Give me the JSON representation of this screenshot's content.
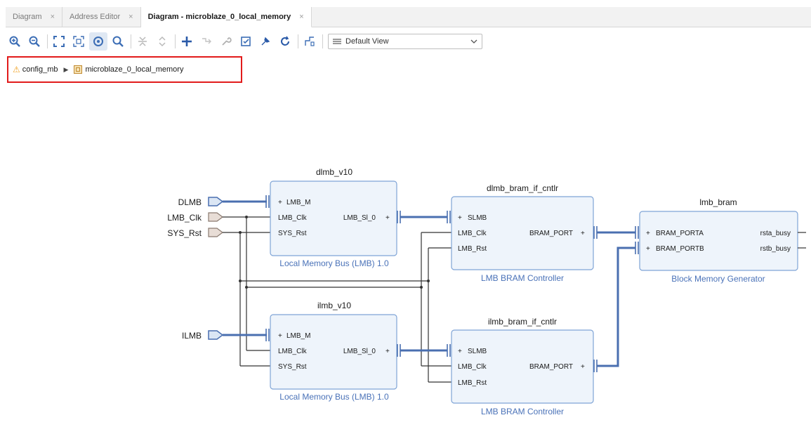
{
  "tabs": [
    {
      "label": "Diagram",
      "active": false
    },
    {
      "label": "Address Editor",
      "active": false
    },
    {
      "label": "Diagram - microblaze_0_local_memory",
      "active": true
    }
  ],
  "tab_close_glyph": "×",
  "toolbar": {
    "icons": [
      "zoom-in-icon",
      "zoom-out-icon",
      "fit-icon",
      "fit-selection-icon",
      "autofit-icon",
      "search-icon",
      "collapse-icon",
      "expand-icon",
      "add-ip-icon",
      "make-connection-icon",
      "settings-icon",
      "validate-icon",
      "run-automation-icon",
      "regenerate-layout-icon",
      "optimize-routing-icon"
    ],
    "view_label": "Default View"
  },
  "breadcrumb": {
    "root": "config_mb",
    "child": "microblaze_0_local_memory"
  },
  "diagram": {
    "ports": [
      "DLMB",
      "LMB_Clk",
      "SYS_Rst",
      "ILMB"
    ],
    "blocks": {
      "dlmb": {
        "title": "dlmb_v10",
        "subtitle": "Local Memory Bus (LMB) 1.0",
        "pins_left": [
          "LMB_M",
          "LMB_Clk",
          "SYS_Rst"
        ],
        "pins_right": [
          "LMB_Sl_0"
        ]
      },
      "ilmb": {
        "title": "ilmb_v10",
        "subtitle": "Local Memory Bus (LMB) 1.0",
        "pins_left": [
          "LMB_M",
          "LMB_Clk",
          "SYS_Rst"
        ],
        "pins_right": [
          "LMB_Sl_0"
        ]
      },
      "dlmb_ctrl": {
        "title": "dlmb_bram_if_cntlr",
        "subtitle": "LMB BRAM Controller",
        "pins_left": [
          "SLMB",
          "LMB_Clk",
          "LMB_Rst"
        ],
        "pins_right": [
          "BRAM_PORT"
        ]
      },
      "ilmb_ctrl": {
        "title": "ilmb_bram_if_cntlr",
        "subtitle": "LMB BRAM Controller",
        "pins_left": [
          "SLMB",
          "LMB_Clk",
          "LMB_Rst"
        ],
        "pins_right": [
          "BRAM_PORT"
        ]
      },
      "bram": {
        "title": "lmb_bram",
        "subtitle": "Block Memory Generator",
        "pins_left": [
          "BRAM_PORTA",
          "BRAM_PORTB"
        ],
        "pins_right": [
          "rsta_busy",
          "rstb_busy"
        ]
      }
    }
  },
  "colors": {
    "bus": "#4a6fb0",
    "block_fill": "#eef4fb",
    "block_border": "#7fa4d6",
    "highlight": "#e21b1b",
    "subtitle": "#4a72b8"
  }
}
